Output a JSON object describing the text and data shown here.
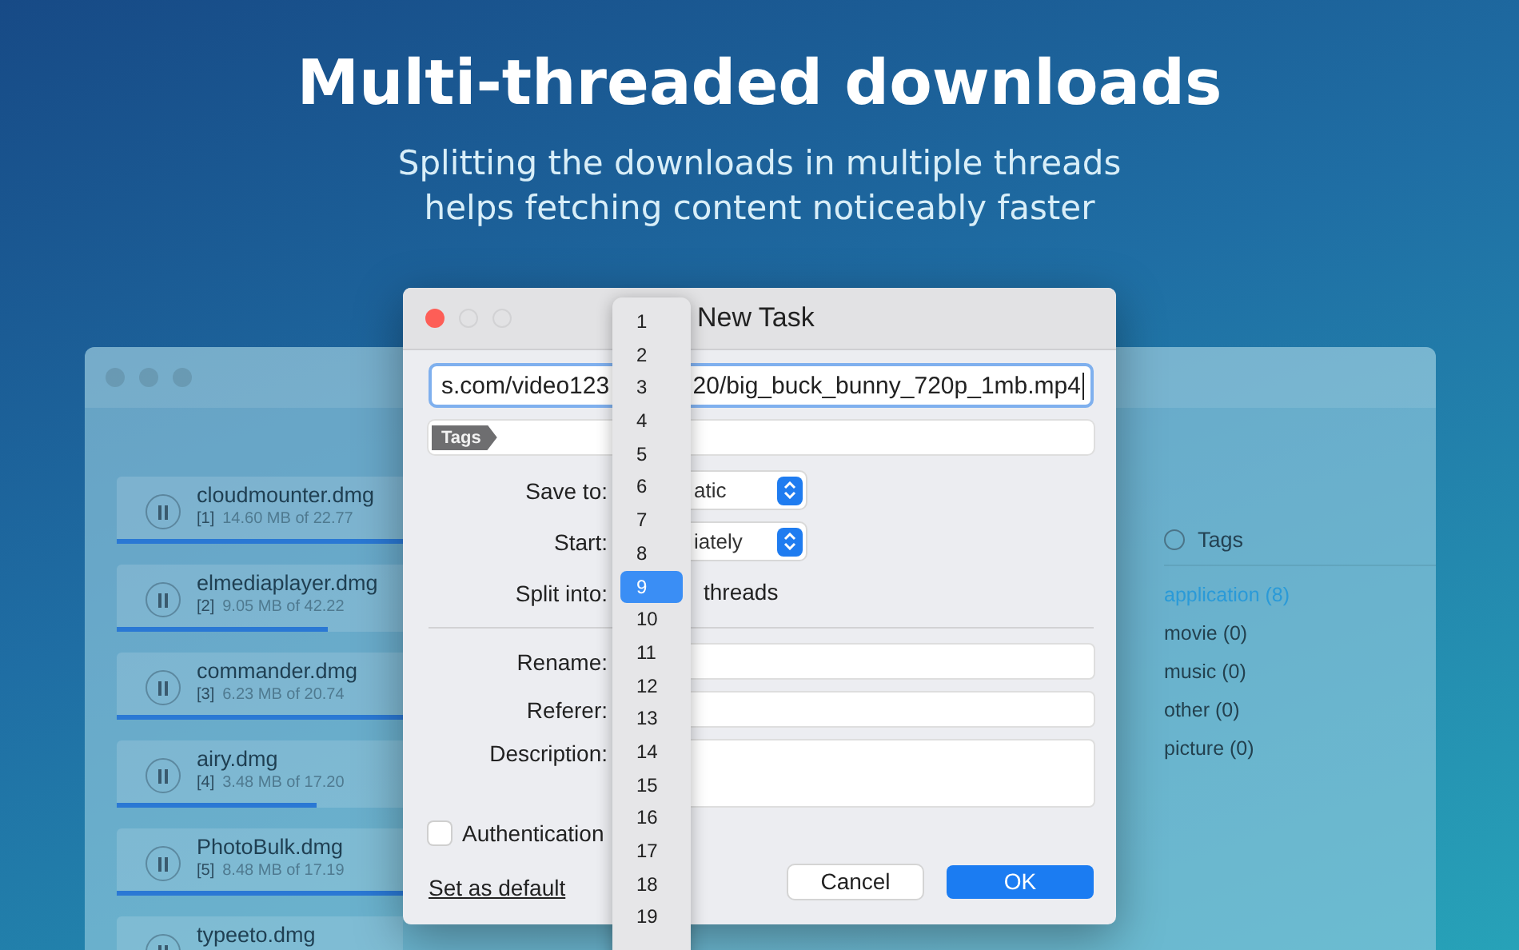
{
  "headline": "Multi-threaded downloads",
  "subtitle_lines": [
    "Splitting the downloads in multiple threads",
    "helps fetching content noticeably faster"
  ],
  "main_window": {
    "downloads": [
      {
        "name": "cloudmounter.dmg",
        "index": "[1]",
        "size": "14.60 MB of 22.77",
        "level": 1
      },
      {
        "name": "elmediaplayer.dmg",
        "index": "[2]",
        "size": "9.05 MB of 42.22",
        "level": 0.74
      },
      {
        "name": "commander.dmg",
        "index": "[3]",
        "size": "6.23 MB of 20.74",
        "level": 1
      },
      {
        "name": "airy.dmg",
        "index": "[4]",
        "size": "3.48 MB of 17.20",
        "level": 0.7
      },
      {
        "name": "PhotoBulk.dmg",
        "index": "[5]",
        "size": "8.48 MB of 17.19",
        "level": 1
      },
      {
        "name": "typeeto.dmg"
      }
    ],
    "tags_panel": {
      "title": "Tags",
      "items": [
        {
          "label": "application (8)",
          "selected": true
        },
        {
          "label": "movie (0)",
          "selected": false
        },
        {
          "label": "music (0)",
          "selected": false
        },
        {
          "label": "other (0)",
          "selected": false
        },
        {
          "label": "picture (0)",
          "selected": false
        }
      ]
    }
  },
  "dialog": {
    "title": "New Task",
    "url_field": {
      "value_start": "s.com/video123",
      "value_end": "20/big_buck_bunny_720p_1mb.mp4"
    },
    "tags_field": {
      "tag": "Tags"
    },
    "save_to": {
      "label": "Save to:",
      "value": "atic"
    },
    "start": {
      "label": "Start:",
      "value": "iately"
    },
    "split": {
      "label": "Split into:",
      "unit": "threads"
    },
    "rename": {
      "label": "Rename:"
    },
    "referer": {
      "label": "Referer:"
    },
    "description": {
      "label": "Description:"
    },
    "authentication": {
      "label": "Authentication",
      "checked": false
    },
    "set_default": "Set as default",
    "buttons": [
      {
        "label": "Cancel",
        "kind": "secondary"
      },
      {
        "label": "OK",
        "kind": "primary"
      }
    ]
  },
  "thread_menu": [
    {
      "label": "1",
      "selected": false
    },
    {
      "label": "2",
      "selected": false
    },
    {
      "label": "3",
      "selected": false
    },
    {
      "label": "4",
      "selected": false
    },
    {
      "label": "5",
      "selected": false
    },
    {
      "label": "6",
      "selected": false
    },
    {
      "label": "7",
      "selected": false
    },
    {
      "label": "8",
      "selected": false
    },
    {
      "label": "9",
      "selected": true
    },
    {
      "label": "10",
      "selected": false
    },
    {
      "label": "11",
      "selected": false
    },
    {
      "label": "12",
      "selected": false
    },
    {
      "label": "13",
      "selected": false
    },
    {
      "label": "14",
      "selected": false
    },
    {
      "label": "15",
      "selected": false
    },
    {
      "label": "16",
      "selected": false
    },
    {
      "label": "17",
      "selected": false
    },
    {
      "label": "18",
      "selected": false
    },
    {
      "label": "19",
      "selected": false
    }
  ]
}
